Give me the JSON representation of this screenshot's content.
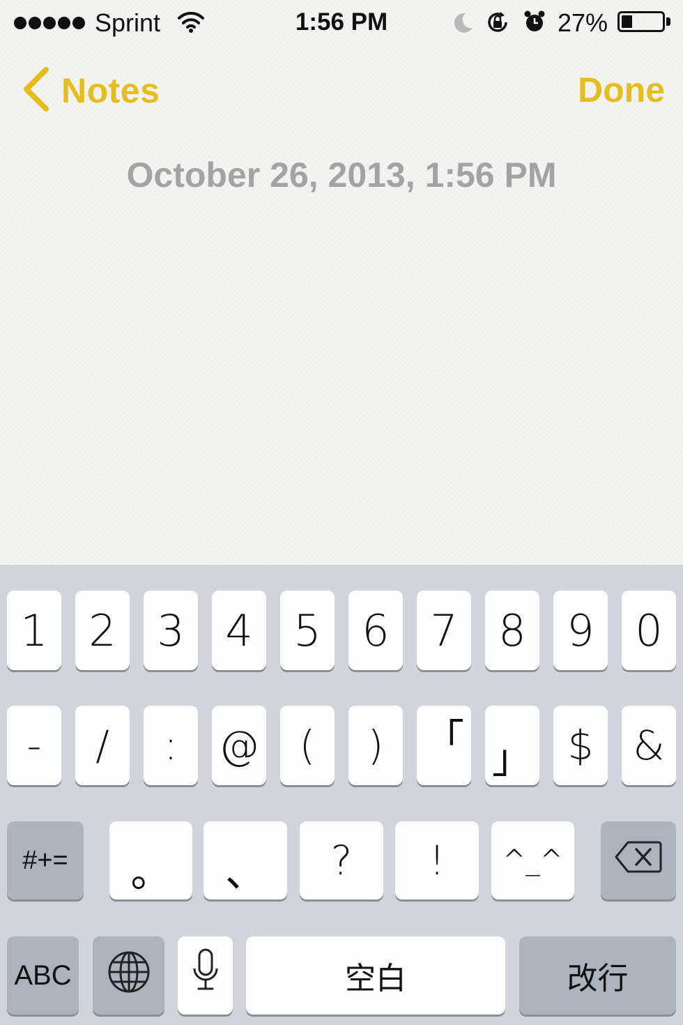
{
  "status_bar": {
    "carrier": "Sprint",
    "time": "1:56 PM",
    "battery_percent": "27%",
    "battery_level": 0.27,
    "signal_bars": 5
  },
  "nav": {
    "back_label": "Notes",
    "done_label": "Done"
  },
  "note": {
    "date": "October 26, 2013, 1:56 PM"
  },
  "keyboard": {
    "row1": [
      "1",
      "2",
      "3",
      "4",
      "5",
      "6",
      "7",
      "8",
      "9",
      "0"
    ],
    "row2": [
      "-",
      "/",
      ":",
      "@",
      "(",
      ")",
      "「",
      "」",
      "$",
      "&"
    ],
    "row3": [
      "。",
      "、",
      "?",
      "!",
      "^_^"
    ],
    "mode_key": "#+=",
    "abc_key": "ABC",
    "space_key": "空白",
    "return_key": "改行"
  },
  "colors": {
    "accent": "#e5bd1f",
    "date_text": "#a3a3a3",
    "keyboard_bg": "#d1d5db",
    "func_key_bg": "#acb3bc"
  },
  "icons": [
    "wifi-icon",
    "moon-icon",
    "rotation-lock-icon",
    "alarm-icon",
    "battery-icon",
    "chevron-left-icon",
    "globe-icon",
    "microphone-icon",
    "backspace-icon"
  ]
}
